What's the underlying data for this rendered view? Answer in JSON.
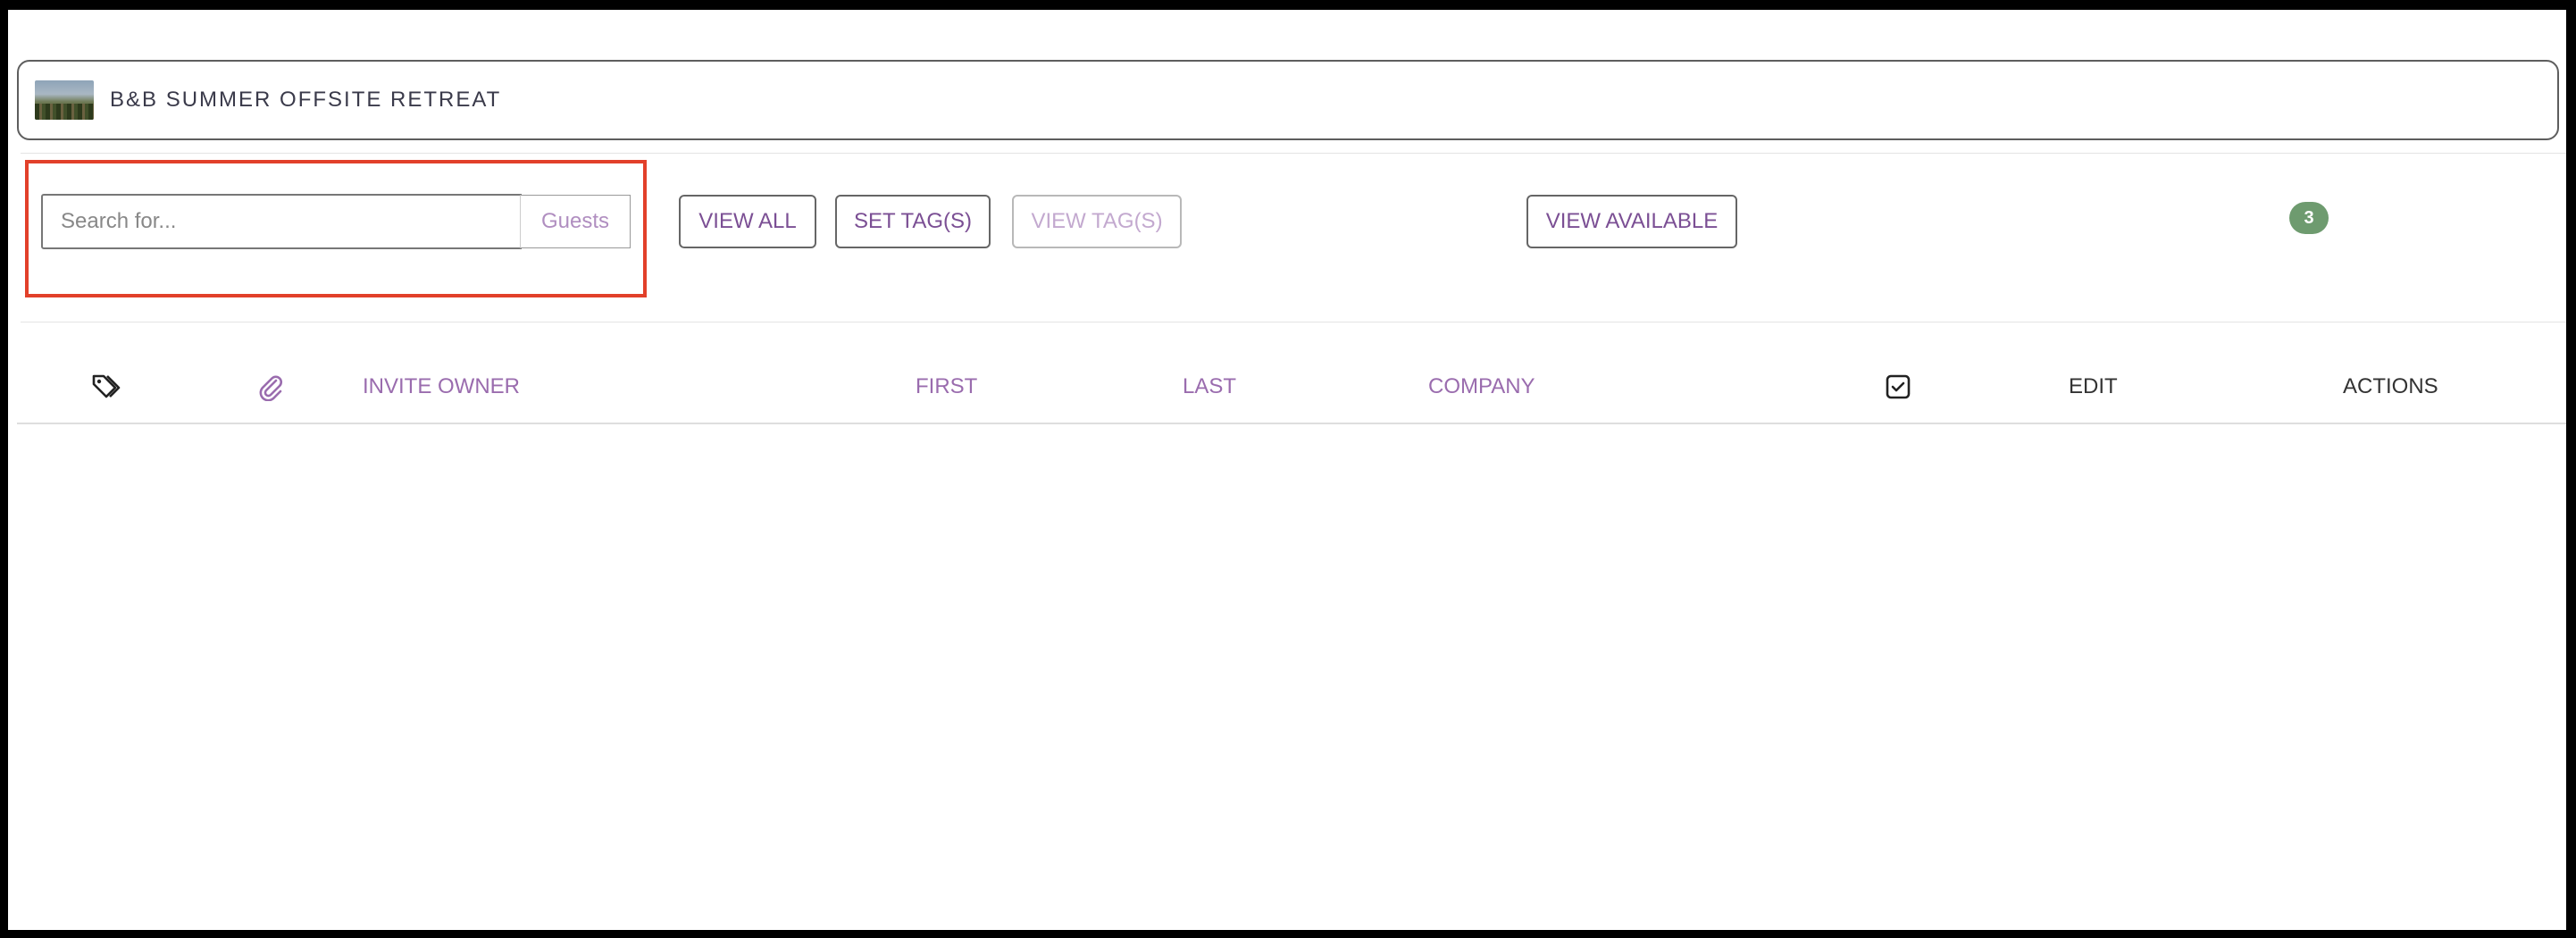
{
  "event": {
    "title": "B&B SUMMER OFFSITE RETREAT",
    "thumbnail_icon": "event-photo"
  },
  "search": {
    "placeholder": "Search for...",
    "value": "",
    "scope_label": "Guests"
  },
  "toolbar": {
    "view_all_label": "VIEW ALL",
    "set_tags_label": "SET TAG(S)",
    "view_tags_label": "VIEW TAG(S)",
    "view_available_label": "VIEW AVAILABLE",
    "badge_count": "3"
  },
  "table": {
    "columns": {
      "tag_icon": "tag-icon",
      "attachment_icon": "paperclip-icon",
      "invite_owner": "INVITE OWNER",
      "first": "FIRST",
      "last": "LAST",
      "company": "COMPANY",
      "checkbox_icon": "checkbox-checked-icon",
      "edit": "EDIT",
      "actions": "ACTIONS"
    },
    "rows": []
  },
  "colors": {
    "accent_purple": "#7b4f94",
    "header_purple": "#9a6cae",
    "badge_green": "#6e9b6f",
    "highlight_red": "#e2402a"
  }
}
